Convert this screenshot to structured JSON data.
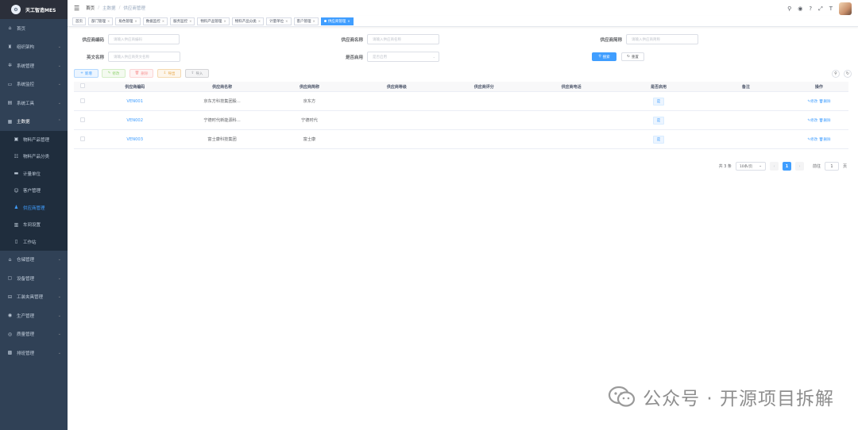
{
  "app": {
    "title": "天工智造MES"
  },
  "sidebar": {
    "items": [
      {
        "label": "首页",
        "icon": "home-icon"
      },
      {
        "label": "组织架构",
        "icon": "org-icon"
      },
      {
        "label": "系统管理",
        "icon": "gear-icon"
      },
      {
        "label": "系统监控",
        "icon": "monitor-icon"
      },
      {
        "label": "系统工具",
        "icon": "tool-icon"
      },
      {
        "label": "主数据",
        "icon": "data-icon"
      }
    ],
    "sub_items": [
      {
        "label": "物料产品管理",
        "icon": "box-icon"
      },
      {
        "label": "物料产品分类",
        "icon": "list-icon"
      },
      {
        "label": "计量单位",
        "icon": "ruler-icon"
      },
      {
        "label": "客户管理",
        "icon": "user-icon"
      },
      {
        "label": "供应商管理",
        "icon": "supplier-icon"
      },
      {
        "label": "车间设置",
        "icon": "workshop-icon"
      },
      {
        "label": "工作站",
        "icon": "station-icon"
      }
    ],
    "bottom_items": [
      {
        "label": "仓储管理",
        "icon": "warehouse-icon"
      },
      {
        "label": "设备管理",
        "icon": "device-icon"
      },
      {
        "label": "工装夹具管理",
        "icon": "fixture-icon"
      },
      {
        "label": "生产管理",
        "icon": "production-icon"
      },
      {
        "label": "质量管理",
        "icon": "quality-icon"
      },
      {
        "label": "排班管理",
        "icon": "schedule-icon"
      }
    ]
  },
  "breadcrumb": {
    "home": "首页",
    "level1": "主数据",
    "current": "供应商管理"
  },
  "tags": [
    "首页",
    "部门管理",
    "角色管理",
    "数据监控",
    "服务监控",
    "物料产品管理",
    "物料产品分类",
    "计量单位",
    "客户管理",
    "供应商管理"
  ],
  "form": {
    "code_label": "供应商编码",
    "code_placeholder": "请输入供应商编码",
    "name_label": "供应商名称",
    "name_placeholder": "请输入供应商名称",
    "nick_label": "供应商简称",
    "nick_placeholder": "请输入供应商简称",
    "en_label": "英文名称",
    "en_placeholder": "请输入供应商英文名称",
    "enable_label": "是否启用",
    "enable_placeholder": "是否启用",
    "search": "搜索",
    "reset": "重置"
  },
  "toolbar": {
    "add": "新增",
    "edit": "修改",
    "delete": "删除",
    "export": "导出",
    "import": "导入"
  },
  "table": {
    "headers": [
      "供应商编码",
      "供应商名称",
      "供应商简称",
      "供应商等级",
      "供应商评分",
      "供应商电话",
      "是否启用",
      "备注",
      "操作"
    ],
    "rows": [
      {
        "code": "VEN001",
        "name": "京东方科技集团股...",
        "nick": "京东方",
        "enabled": "是"
      },
      {
        "code": "VEN002",
        "name": "宁德时代新能源科...",
        "nick": "宁德时代",
        "enabled": "是"
      },
      {
        "code": "VEN003",
        "name": "富士康科技集团",
        "nick": "富士康",
        "enabled": "是"
      }
    ],
    "op_edit": "修改",
    "op_delete": "删除"
  },
  "pagination": {
    "total": "共 3 条",
    "page_size": "10条/页",
    "current": "1",
    "goto": "前往",
    "goto_value": "1",
    "page_unit": "页"
  },
  "watermark": {
    "text": "公众号 · 开源项目拆解"
  }
}
